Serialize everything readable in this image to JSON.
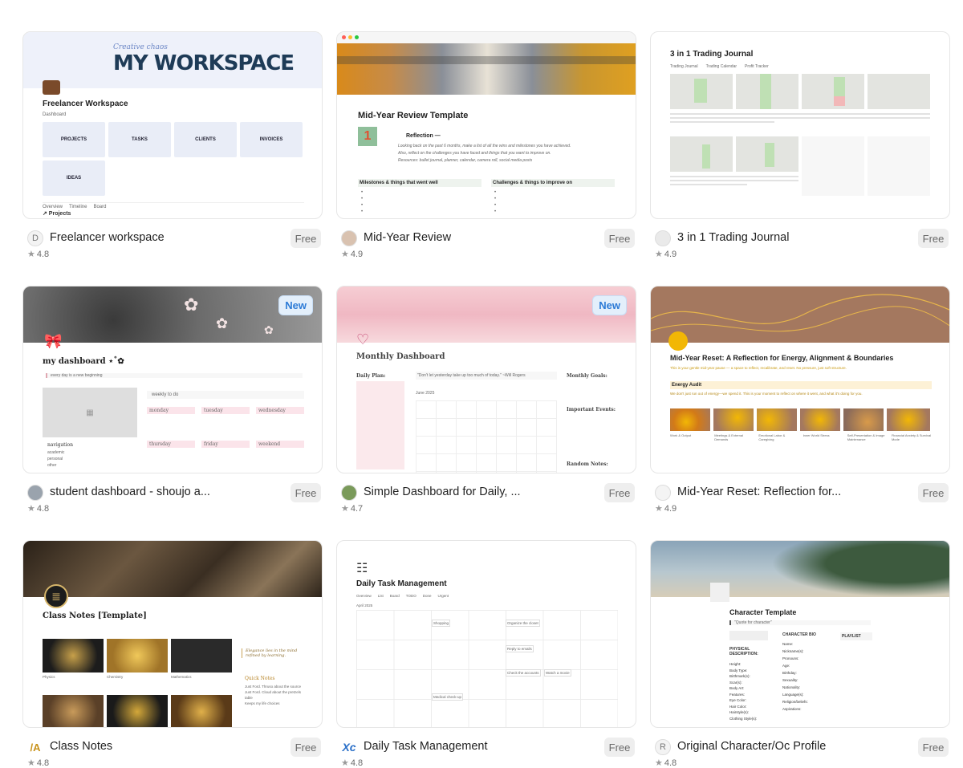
{
  "cards": [
    {
      "title": "Freelancer workspace",
      "price": "Free",
      "rating": "4.8",
      "avatar": "D",
      "preview": {
        "script_text": "Creative chaos",
        "banner_title": "MY WORKSPACE",
        "page_title": "Freelancer Workspace",
        "tag": "Dashboard",
        "tiles": [
          "PROJECTS",
          "TASKS",
          "CLIENTS",
          "INVOICES",
          "IDEAS"
        ],
        "tabs": [
          "Overview",
          "Timeline",
          "Board"
        ],
        "section": "↗ Projects"
      }
    },
    {
      "title": "Mid-Year Review",
      "price": "Free",
      "rating": "4.9",
      "preview": {
        "page_title": "Mid-Year Review Template",
        "heading": "Reflection —",
        "text1": "Looking back on the past 6 months, make a list of all the wins and milestones you have achieved.",
        "text2": "Also, reflect on the challenges you have faced and things that you want to improve on.",
        "text3": "Resources: bullet journal, planner, calendar, camera roll, social media posts",
        "col1": "Milestones & things that went well",
        "col2": "Challenges & things to improve on"
      }
    },
    {
      "title": "3 in 1 Trading Journal",
      "price": "Free",
      "rating": "4.9",
      "preview": {
        "page_title": "3 in 1 Trading Journal",
        "tabs": [
          "Trading Journal",
          "Trading Calendar",
          "Profit Tracker"
        ]
      }
    },
    {
      "title": "student dashboard - shoujo a...",
      "price": "Free",
      "rating": "4.8",
      "badge": "New",
      "preview": {
        "page_title": "my dashboard ⋆˚✿",
        "quote": "every day is a new beginning",
        "todo": "weekly to do",
        "days": [
          "monday",
          "tuesday",
          "wednesday",
          "thursday",
          "friday",
          "weekend"
        ],
        "nav": "navigation",
        "nav_items": [
          "academic",
          "personal",
          "other"
        ]
      }
    },
    {
      "title": "Simple Dashboard for Daily, ...",
      "price": "Free",
      "rating": "4.7",
      "badge": "New",
      "preview": {
        "page_title": "Monthly Dashboard",
        "daily": "Daily Plan:",
        "quote": "\"Don't let yesterday take up too much of today.\" ~Will Rogers",
        "month": "June 2025",
        "goals": "Monthly Goals:",
        "events": "Important Events:",
        "random": "Random Notes:"
      }
    },
    {
      "title": "Mid-Year Reset: Reflection for...",
      "price": "Free",
      "rating": "4.9",
      "preview": {
        "page_title": "Mid-Year Reset: A Reflection for Energy, Alignment & Boundaries",
        "subtitle": "This is your gentle mid-year pause — a space to reflect, recalibrate, and reset. No pressure, just soft structure.",
        "audit": "Energy Audit",
        "audit_text": "We don't just run out of energy—we spend it. This is your moment to reflect on where it went, and what it's doing for you.",
        "items": [
          "Work & Output",
          "Meetings & External Demands",
          "Emotional Labor & Caregiving",
          "Inner World Stress",
          "Self-Presentation & Image Maintenance",
          "Financial Anxiety & Survival Mode"
        ]
      }
    },
    {
      "title": "Class Notes",
      "price": "Free",
      "rating": "4.8",
      "preview": {
        "page_title": "Class Notes [Template]",
        "quote": "Elegance lies in the mind refined by learning.",
        "quick": "Quick Notes",
        "notes": [
          "Just Ford. Thruso about the source",
          "Just Ford. Cloud about the pretzels table",
          "Keeps my life choices"
        ],
        "subjects": [
          "Physics",
          "Chemistry",
          "Mathematics"
        ]
      }
    },
    {
      "title": "Daily Task Management",
      "price": "Free",
      "rating": "4.8",
      "preview": {
        "page_title": "Daily Task Management",
        "month": "April 2025",
        "tabs": [
          "Overview",
          "List",
          "Board",
          "TODO",
          "Done",
          "Urgent"
        ],
        "tasks": [
          "Shopping",
          "Organize the closet",
          "Reply to emails",
          "Check the accounts",
          "Watch a movie",
          "Medical check-up"
        ]
      }
    },
    {
      "title": "Original Character/Oc Profile",
      "price": "Free",
      "rating": "4.8",
      "avatar": "R",
      "preview": {
        "page_title": "Character Template",
        "quote": "\"Quote for character\"",
        "physical": "PHYSICAL DESCRIPTION:",
        "bio": "CHARACTER BIO",
        "playlist": "PLAYLIST",
        "bio_fields": [
          "Name:",
          "Nickname(s):",
          "Pronouns:",
          "Age:",
          "Birthday:",
          "Sexuality:",
          "Nationality:",
          "Language(s):",
          "Religion/beliefs:",
          "Aspirations:"
        ],
        "phys_fields": [
          "Height:",
          "Body Type:",
          "Birthmark(s):",
          "Scar(s):",
          "Body Art:",
          "Features:",
          "Eye Color:",
          "Hair Color:",
          "Hairstyle(s):",
          "Clothing Style(s):"
        ]
      }
    }
  ]
}
